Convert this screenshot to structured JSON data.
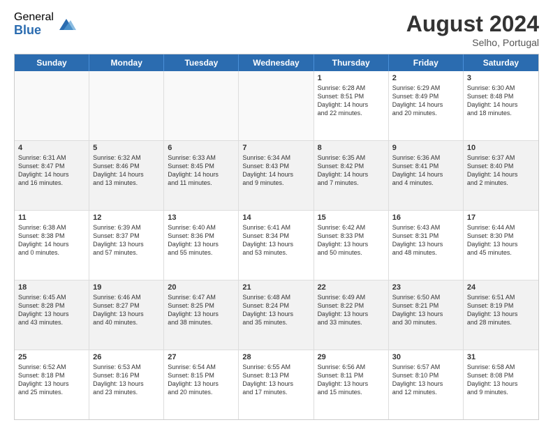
{
  "logo": {
    "general": "General",
    "blue": "Blue"
  },
  "title": "August 2024",
  "subtitle": "Selho, Portugal",
  "header_days": [
    "Sunday",
    "Monday",
    "Tuesday",
    "Wednesday",
    "Thursday",
    "Friday",
    "Saturday"
  ],
  "rows": [
    [
      {
        "day": "",
        "text": "",
        "empty": true
      },
      {
        "day": "",
        "text": "",
        "empty": true
      },
      {
        "day": "",
        "text": "",
        "empty": true
      },
      {
        "day": "",
        "text": "",
        "empty": true
      },
      {
        "day": "1",
        "text": "Sunrise: 6:28 AM\nSunset: 8:51 PM\nDaylight: 14 hours\nand 22 minutes.",
        "empty": false
      },
      {
        "day": "2",
        "text": "Sunrise: 6:29 AM\nSunset: 8:49 PM\nDaylight: 14 hours\nand 20 minutes.",
        "empty": false
      },
      {
        "day": "3",
        "text": "Sunrise: 6:30 AM\nSunset: 8:48 PM\nDaylight: 14 hours\nand 18 minutes.",
        "empty": false
      }
    ],
    [
      {
        "day": "4",
        "text": "Sunrise: 6:31 AM\nSunset: 8:47 PM\nDaylight: 14 hours\nand 16 minutes.",
        "empty": false
      },
      {
        "day": "5",
        "text": "Sunrise: 6:32 AM\nSunset: 8:46 PM\nDaylight: 14 hours\nand 13 minutes.",
        "empty": false
      },
      {
        "day": "6",
        "text": "Sunrise: 6:33 AM\nSunset: 8:45 PM\nDaylight: 14 hours\nand 11 minutes.",
        "empty": false
      },
      {
        "day": "7",
        "text": "Sunrise: 6:34 AM\nSunset: 8:43 PM\nDaylight: 14 hours\nand 9 minutes.",
        "empty": false
      },
      {
        "day": "8",
        "text": "Sunrise: 6:35 AM\nSunset: 8:42 PM\nDaylight: 14 hours\nand 7 minutes.",
        "empty": false
      },
      {
        "day": "9",
        "text": "Sunrise: 6:36 AM\nSunset: 8:41 PM\nDaylight: 14 hours\nand 4 minutes.",
        "empty": false
      },
      {
        "day": "10",
        "text": "Sunrise: 6:37 AM\nSunset: 8:40 PM\nDaylight: 14 hours\nand 2 minutes.",
        "empty": false
      }
    ],
    [
      {
        "day": "11",
        "text": "Sunrise: 6:38 AM\nSunset: 8:38 PM\nDaylight: 14 hours\nand 0 minutes.",
        "empty": false
      },
      {
        "day": "12",
        "text": "Sunrise: 6:39 AM\nSunset: 8:37 PM\nDaylight: 13 hours\nand 57 minutes.",
        "empty": false
      },
      {
        "day": "13",
        "text": "Sunrise: 6:40 AM\nSunset: 8:36 PM\nDaylight: 13 hours\nand 55 minutes.",
        "empty": false
      },
      {
        "day": "14",
        "text": "Sunrise: 6:41 AM\nSunset: 8:34 PM\nDaylight: 13 hours\nand 53 minutes.",
        "empty": false
      },
      {
        "day": "15",
        "text": "Sunrise: 6:42 AM\nSunset: 8:33 PM\nDaylight: 13 hours\nand 50 minutes.",
        "empty": false
      },
      {
        "day": "16",
        "text": "Sunrise: 6:43 AM\nSunset: 8:31 PM\nDaylight: 13 hours\nand 48 minutes.",
        "empty": false
      },
      {
        "day": "17",
        "text": "Sunrise: 6:44 AM\nSunset: 8:30 PM\nDaylight: 13 hours\nand 45 minutes.",
        "empty": false
      }
    ],
    [
      {
        "day": "18",
        "text": "Sunrise: 6:45 AM\nSunset: 8:28 PM\nDaylight: 13 hours\nand 43 minutes.",
        "empty": false
      },
      {
        "day": "19",
        "text": "Sunrise: 6:46 AM\nSunset: 8:27 PM\nDaylight: 13 hours\nand 40 minutes.",
        "empty": false
      },
      {
        "day": "20",
        "text": "Sunrise: 6:47 AM\nSunset: 8:25 PM\nDaylight: 13 hours\nand 38 minutes.",
        "empty": false
      },
      {
        "day": "21",
        "text": "Sunrise: 6:48 AM\nSunset: 8:24 PM\nDaylight: 13 hours\nand 35 minutes.",
        "empty": false
      },
      {
        "day": "22",
        "text": "Sunrise: 6:49 AM\nSunset: 8:22 PM\nDaylight: 13 hours\nand 33 minutes.",
        "empty": false
      },
      {
        "day": "23",
        "text": "Sunrise: 6:50 AM\nSunset: 8:21 PM\nDaylight: 13 hours\nand 30 minutes.",
        "empty": false
      },
      {
        "day": "24",
        "text": "Sunrise: 6:51 AM\nSunset: 8:19 PM\nDaylight: 13 hours\nand 28 minutes.",
        "empty": false
      }
    ],
    [
      {
        "day": "25",
        "text": "Sunrise: 6:52 AM\nSunset: 8:18 PM\nDaylight: 13 hours\nand 25 minutes.",
        "empty": false
      },
      {
        "day": "26",
        "text": "Sunrise: 6:53 AM\nSunset: 8:16 PM\nDaylight: 13 hours\nand 23 minutes.",
        "empty": false
      },
      {
        "day": "27",
        "text": "Sunrise: 6:54 AM\nSunset: 8:15 PM\nDaylight: 13 hours\nand 20 minutes.",
        "empty": false
      },
      {
        "day": "28",
        "text": "Sunrise: 6:55 AM\nSunset: 8:13 PM\nDaylight: 13 hours\nand 17 minutes.",
        "empty": false
      },
      {
        "day": "29",
        "text": "Sunrise: 6:56 AM\nSunset: 8:11 PM\nDaylight: 13 hours\nand 15 minutes.",
        "empty": false
      },
      {
        "day": "30",
        "text": "Sunrise: 6:57 AM\nSunset: 8:10 PM\nDaylight: 13 hours\nand 12 minutes.",
        "empty": false
      },
      {
        "day": "31",
        "text": "Sunrise: 6:58 AM\nSunset: 8:08 PM\nDaylight: 13 hours\nand 9 minutes.",
        "empty": false
      }
    ]
  ]
}
